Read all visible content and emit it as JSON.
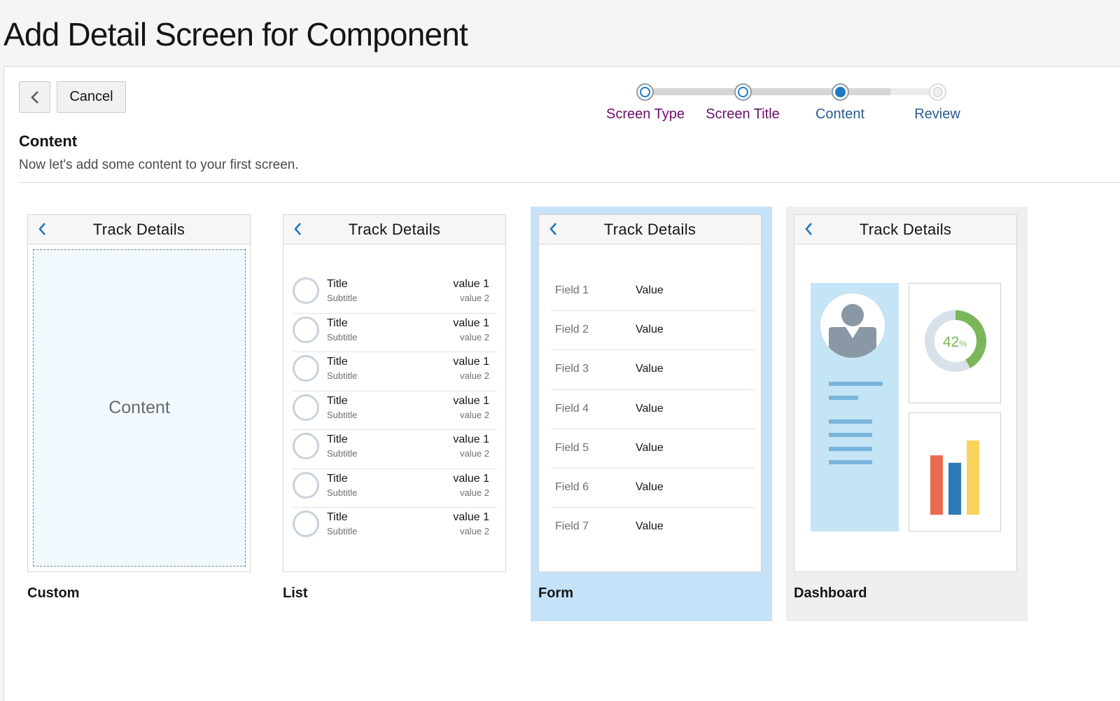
{
  "page": {
    "title": "Add Detail Screen for Component"
  },
  "toolbar": {
    "cancel_label": "Cancel"
  },
  "train": {
    "steps": [
      {
        "label": "Screen Type",
        "state": "visited"
      },
      {
        "label": "Screen Title",
        "state": "visited"
      },
      {
        "label": "Content",
        "state": "current"
      },
      {
        "label": "Review",
        "state": "future"
      }
    ]
  },
  "section": {
    "heading": "Content",
    "description": "Now let's add some content to your first screen."
  },
  "options": {
    "header_title": "Track Details",
    "custom": {
      "label": "Custom",
      "content_text": "Content"
    },
    "list": {
      "label": "List",
      "rows": [
        {
          "title": "Title",
          "subtitle": "Subtitle",
          "value1": "value 1",
          "value2": "value 2"
        },
        {
          "title": "Title",
          "subtitle": "Subtitle",
          "value1": "value 1",
          "value2": "value 2"
        },
        {
          "title": "Title",
          "subtitle": "Subtitle",
          "value1": "value 1",
          "value2": "value 2"
        },
        {
          "title": "Title",
          "subtitle": "Subtitle",
          "value1": "value 1",
          "value2": "value 2"
        },
        {
          "title": "Title",
          "subtitle": "Subtitle",
          "value1": "value 1",
          "value2": "value 2"
        },
        {
          "title": "Title",
          "subtitle": "Subtitle",
          "value1": "value 1",
          "value2": "value 2"
        },
        {
          "title": "Title",
          "subtitle": "Subtitle",
          "value1": "value 1",
          "value2": "value 2"
        }
      ]
    },
    "form": {
      "label": "Form",
      "selected": true,
      "rows": [
        {
          "field": "Field 1",
          "value": "Value"
        },
        {
          "field": "Field 2",
          "value": "Value"
        },
        {
          "field": "Field 3",
          "value": "Value"
        },
        {
          "field": "Field 4",
          "value": "Value"
        },
        {
          "field": "Field 5",
          "value": "Value"
        },
        {
          "field": "Field 6",
          "value": "Value"
        },
        {
          "field": "Field 7",
          "value": "Value"
        }
      ]
    },
    "dashboard": {
      "label": "Dashboard",
      "donut_value": "42",
      "donut_unit": "%",
      "donut_fraction": 0.42,
      "bar_colors": [
        "#ea6a4e",
        "#2c7bb6",
        "#f7d35c"
      ],
      "bar_levels": [
        0.8,
        0.7,
        1.0
      ]
    }
  },
  "colors": {
    "accent": "#1d7ac2",
    "selected_bg": "#c5e2f8",
    "visited_step": "#6b0e6b",
    "donut_green": "#7cb65a"
  },
  "icons": {
    "back": "chevron-left-icon",
    "header_back": "chevron-left-icon",
    "avatar": "user-avatar-icon",
    "donut": "donut-chart-icon",
    "bars": "bar-chart-icon"
  }
}
